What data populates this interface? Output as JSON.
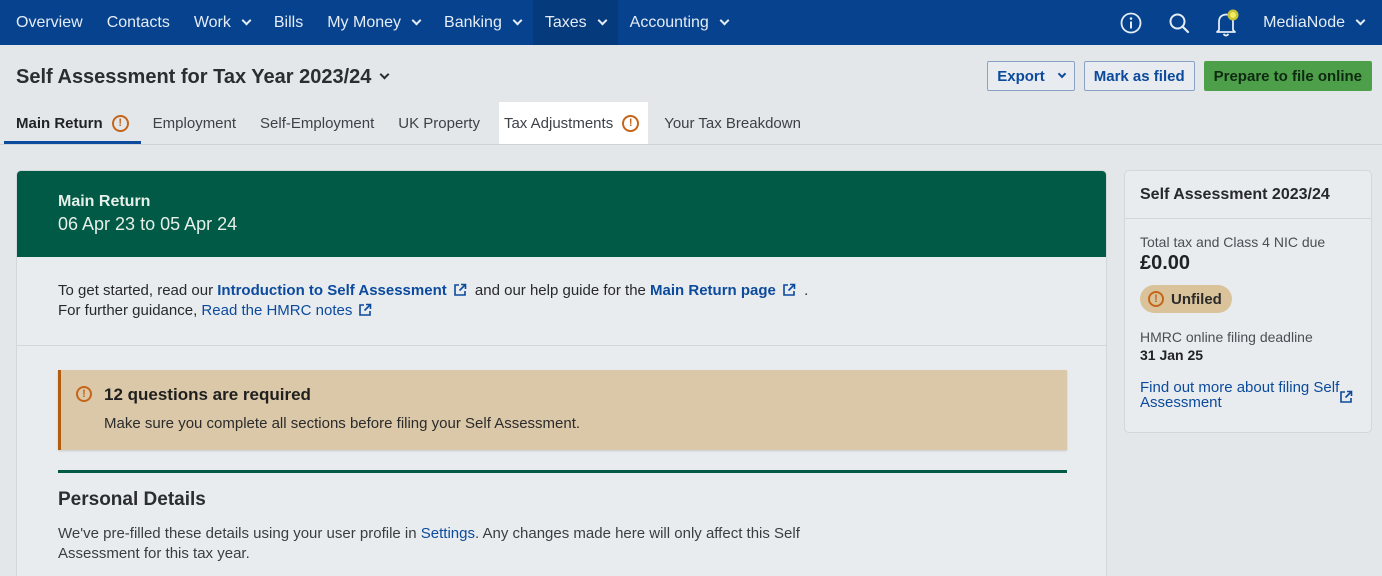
{
  "topnav": {
    "items": [
      {
        "label": "Overview",
        "dropdown": false,
        "active": false
      },
      {
        "label": "Contacts",
        "dropdown": false,
        "active": false
      },
      {
        "label": "Work",
        "dropdown": true,
        "active": false
      },
      {
        "label": "Bills",
        "dropdown": false,
        "active": false
      },
      {
        "label": "My Money",
        "dropdown": true,
        "active": false
      },
      {
        "label": "Banking",
        "dropdown": true,
        "active": false
      },
      {
        "label": "Taxes",
        "dropdown": true,
        "active": true
      },
      {
        "label": "Accounting",
        "dropdown": true,
        "active": false
      }
    ],
    "user": "MediaNode",
    "icons": [
      "info-icon",
      "search-icon",
      "bell-icon"
    ]
  },
  "header": {
    "title": "Self Assessment for Tax Year 2023/24",
    "export_label": "Export",
    "mark_filed_label": "Mark as filed",
    "prepare_label": "Prepare to file online"
  },
  "tabs": [
    {
      "label": "Main Return",
      "warning": true
    },
    {
      "label": "Employment",
      "warning": false
    },
    {
      "label": "Self-Employment",
      "warning": false
    },
    {
      "label": "UK Property",
      "warning": false
    },
    {
      "label": "Tax Adjustments",
      "warning": true
    },
    {
      "label": "Your Tax Breakdown",
      "warning": false
    }
  ],
  "main": {
    "heading": "Main Return",
    "period": "06 Apr 23 to 05 Apr 24",
    "intro": {
      "prefix": "To get started, read our ",
      "link1": "Introduction to Self Assessment",
      "middle": " and our help guide for the ",
      "link2": "Main Return page",
      "suffix": " .",
      "line2_prefix": "For further guidance, ",
      "link3": "Read the HMRC notes"
    },
    "alert": {
      "title": "12 questions are required",
      "text": "Make sure you complete all sections before filing your Self Assessment."
    },
    "personal": {
      "title": "Personal Details",
      "text_prefix": "We've pre-filled these details using your user profile in ",
      "settings_link": "Settings",
      "text_suffix": ". Any changes made here will only affect this Self Assessment for this tax year."
    }
  },
  "side": {
    "title": "Self Assessment 2023/24",
    "total_label": "Total tax and Class 4 NIC due",
    "total_value": "£0.00",
    "status": "Unfiled",
    "deadline_label": "HMRC online filing deadline",
    "deadline_value": "31 Jan 25",
    "link": "Find out more about filing Self Assessment"
  },
  "colors": {
    "nav": "#06428d",
    "brand_green": "#005a45",
    "primary_button": "#4e9f4a",
    "link": "#0b4a9c",
    "warning": "#c4651a"
  }
}
